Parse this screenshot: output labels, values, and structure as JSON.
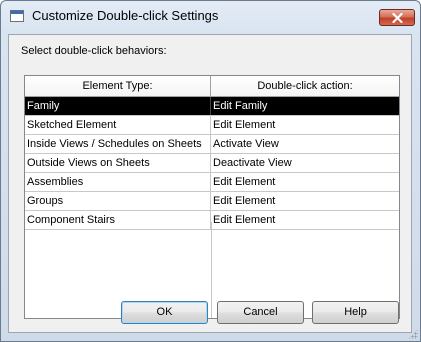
{
  "window": {
    "title": "Customize Double-click Settings"
  },
  "instruction": "Select double-click behaviors:",
  "grid": {
    "headers": [
      "Element Type:",
      "Double-click action:"
    ],
    "rows": [
      {
        "type": "Family",
        "action": "Edit Family"
      },
      {
        "type": "Sketched Element",
        "action": "Edit Element"
      },
      {
        "type": "Inside Views / Schedules on Sheets",
        "action": "Activate View"
      },
      {
        "type": "Outside Views on Sheets",
        "action": "Deactivate View"
      },
      {
        "type": "Assemblies",
        "action": "Edit Element"
      },
      {
        "type": "Groups",
        "action": "Edit Element"
      },
      {
        "type": "Component Stairs",
        "action": "Edit Element"
      }
    ],
    "selected_index": 0
  },
  "buttons": {
    "ok": "OK",
    "cancel": "Cancel",
    "help": "Help"
  },
  "icons": {
    "app": "dialog-window-icon",
    "close": "close-icon",
    "grip": "resize-grip-icon"
  }
}
